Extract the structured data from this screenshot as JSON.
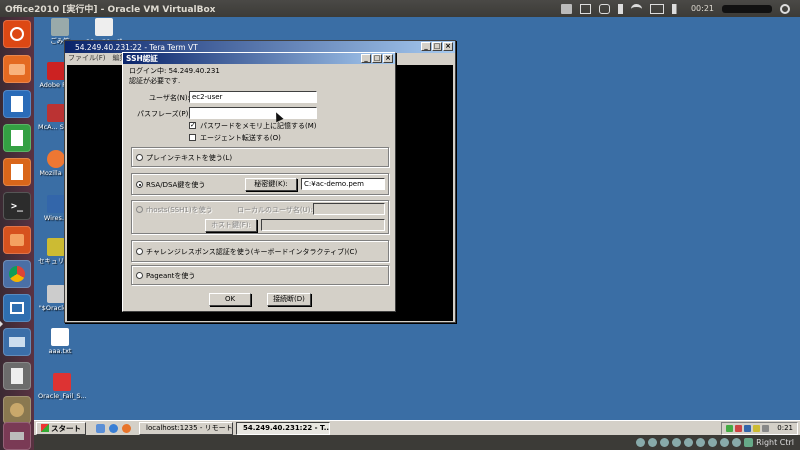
{
  "top_panel": {
    "title": "Office2010 [実行中] - Oracle VM VirtualBox",
    "time": "00:21"
  },
  "desktop": {
    "icons": [
      {
        "label": "ごみ箱",
        "color": "#9aa"
      },
      {
        "label": "ac-...pe...ct",
        "color": "#eee"
      },
      {
        "label": "Adobe R...",
        "color": "#c22"
      },
      {
        "label": "McA... Security",
        "color": "#b33"
      },
      {
        "label": "Mozilla F...",
        "color": "#e73"
      },
      {
        "label": "Wires...",
        "color": "#36a"
      },
      {
        "label": "セキュリティ成ウィ...",
        "color": "#cb3"
      },
      {
        "label": "\"$Oracle...",
        "color": "#ccc"
      },
      {
        "label": "aaa.txt",
        "color": "#fff"
      },
      {
        "label": "Oracle_Fail_S...",
        "color": "#d33"
      }
    ]
  },
  "terminal": {
    "title": "54.249.40.231:22 - Tera Term VT",
    "menu": [
      "ファイル(F)",
      "編集(E)"
    ]
  },
  "ssh_dialog": {
    "title": "SSH認証",
    "login_status": "ログイン中: 54.249.40.231",
    "auth_required": "認証が必要です.",
    "username_label": "ユーザ名(N):",
    "username_value": "ec2-user",
    "passphrase_label": "パスフレーズ(P):",
    "passphrase_value": "",
    "remember_label": "パスワードをメモリ上に記憶する(M)",
    "remember_checked": "✓",
    "agent_label": "エージェント転送する(O)",
    "plaintext_label": "プレインテキストを使う(L)",
    "rsa_label": "RSA/DSA鍵を使う",
    "private_key_button": "秘密鍵(K):",
    "private_key_value": "C:¥ac-demo.pem",
    "rhosts_label": "rhosts(SSH1)を使う",
    "local_user_label": "ローカルのユーザ名(U):",
    "host_key_button": "ホスト鍵(F):",
    "challenge_label": "チャレンジレスポンス認証を使う(キーボードインタラクティブ)(C)",
    "pageant_label": "Pageantを使う",
    "ok_button": "OK",
    "disconnect_button": "接続断(D)"
  },
  "guest_taskbar": {
    "start_label": "スタート",
    "tasks": [
      "localhost:1235 - リモート...",
      "54.249.40.231:22 - T..."
    ],
    "clock": "0:21"
  },
  "vbox_status": {
    "host_key": "Right Ctrl"
  }
}
